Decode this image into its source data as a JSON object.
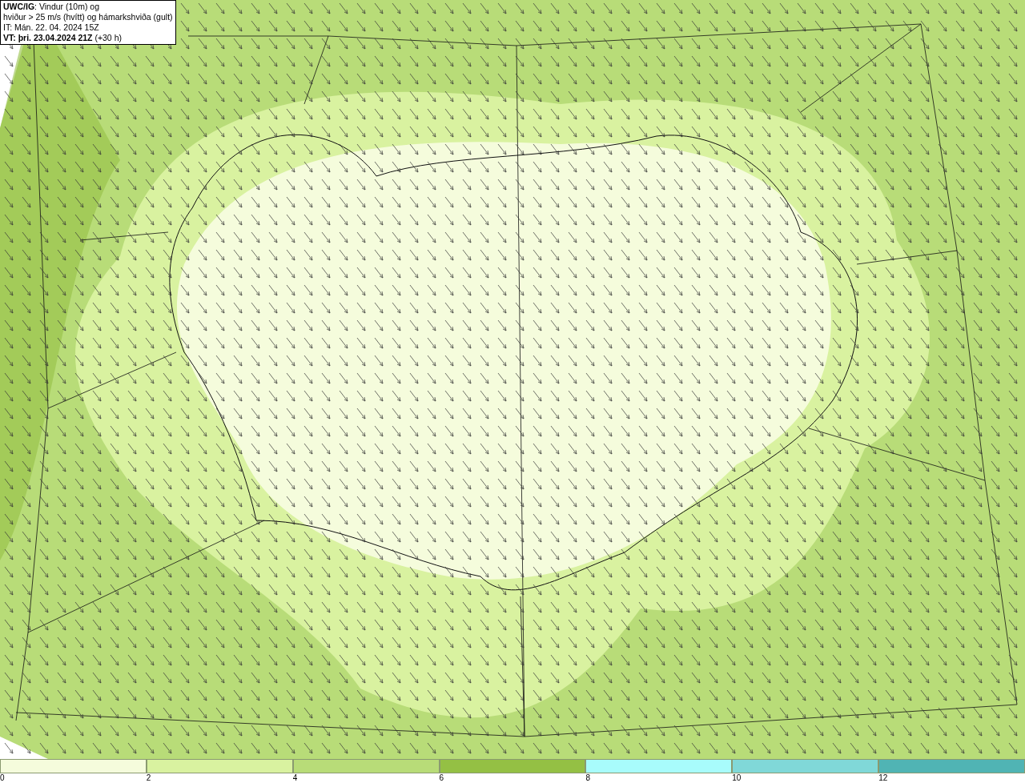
{
  "legend": {
    "lines": [
      "**UWC/IG**: Vindur (10m) og",
      "hviður > 25 m/s (hvítt) og hámarkshviða (gult)",
      "IT: Mán. 22. 04. 2024 15Z",
      "**VT: þri. 23.04.2024 21Z** (+30 h)"
    ]
  },
  "colorbar": {
    "segments": [
      {
        "color": "#f5fcdc",
        "label": "0"
      },
      {
        "color": "#d9f2a0",
        "label": "2"
      },
      {
        "color": "#b8dc78",
        "label": "4"
      },
      {
        "color": "#94c044",
        "label": "6"
      },
      {
        "color": "#a8fcfc",
        "label": "8"
      },
      {
        "color": "#80d8d8",
        "label": "10"
      },
      {
        "color": "#50b4b4",
        "label": "12"
      }
    ]
  }
}
